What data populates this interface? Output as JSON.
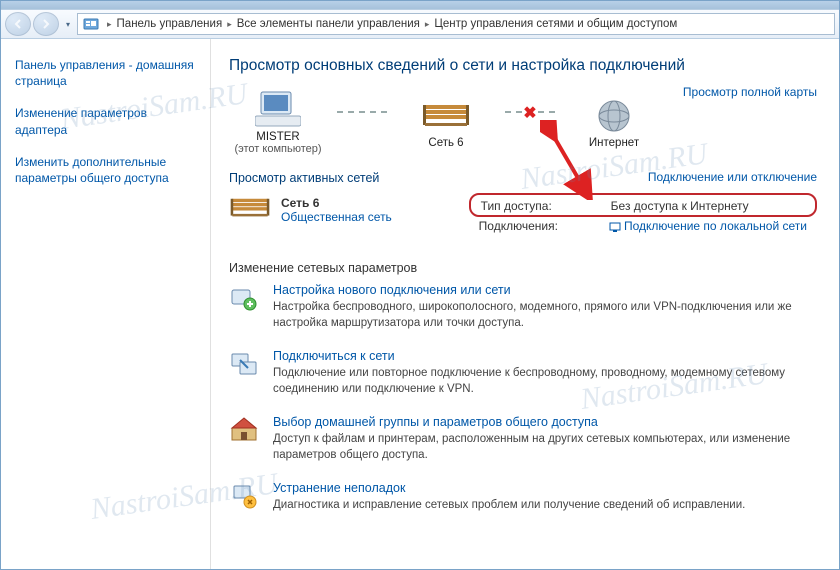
{
  "breadcrumb": {
    "seg1": "Панель управления",
    "seg2": "Все элементы панели управления",
    "seg3": "Центр управления сетями и общим доступом"
  },
  "sidebar": {
    "items": [
      {
        "label": "Панель управления - домашняя страница"
      },
      {
        "label": "Изменение параметров адаптера"
      },
      {
        "label": "Изменить дополнительные параметры общего доступа"
      }
    ]
  },
  "heading": "Просмотр основных сведений о сети и настройка подключений",
  "full_map": "Просмотр полной карты",
  "nodes": {
    "pc": {
      "label": "MISTER",
      "sub": "(этот компьютер)"
    },
    "net": {
      "label": "Сеть 6"
    },
    "inet": {
      "label": "Интернет"
    }
  },
  "active_networks_title": "Просмотр активных сетей",
  "connect_disconnect": "Подключение или отключение",
  "active_net": {
    "name": "Сеть 6",
    "type": "Общественная сеть"
  },
  "details": {
    "access_label": "Тип доступа:",
    "access_value": "Без доступа к Интернету",
    "conn_label": "Подключения:",
    "conn_value": "Подключение по локальной сети"
  },
  "change_params_title": "Изменение сетевых параметров",
  "tasks": [
    {
      "title": "Настройка нового подключения или сети",
      "desc": "Настройка беспроводного, широкополосного, модемного, прямого или VPN-подключения или же настройка маршрутизатора или точки доступа."
    },
    {
      "title": "Подключиться к сети",
      "desc": "Подключение или повторное подключение к беспроводному, проводному, модемному сетевому соединению или подключение к VPN."
    },
    {
      "title": "Выбор домашней группы и параметров общего доступа",
      "desc": "Доступ к файлам и принтерам, расположенным на других сетевых компьютерах, или изменение параметров общего доступа."
    },
    {
      "title": "Устранение неполадок",
      "desc": "Диагностика и исправление сетевых проблем или получение сведений об исправлении."
    }
  ],
  "watermark": "NastroiSam.RU"
}
